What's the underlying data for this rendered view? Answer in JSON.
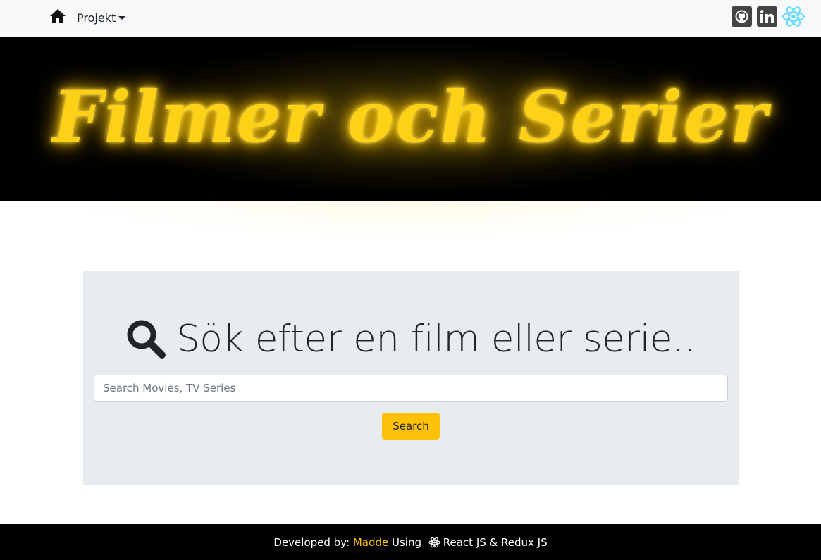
{
  "navbar": {
    "home_icon": "home-icon",
    "dropdown_label": "Projekt",
    "social": [
      {
        "name": "github-icon"
      },
      {
        "name": "linkedin-icon"
      },
      {
        "name": "react-icon",
        "color": "#61dafb"
      }
    ]
  },
  "hero": {
    "title": "Filmer och Serier",
    "title_color": "#fcd116"
  },
  "search": {
    "heading": "Sök efter en film eller serie..",
    "icon": "search-icon",
    "placeholder": "Search Movies, TV Series",
    "value": "",
    "button_label": "Search",
    "button_color": "#ffc107"
  },
  "footer": {
    "prefix": "Developed by: ",
    "author": "Madde",
    "middle": " Using ",
    "suffix": "React JS & Redux JS",
    "author_color": "#ffc107"
  }
}
